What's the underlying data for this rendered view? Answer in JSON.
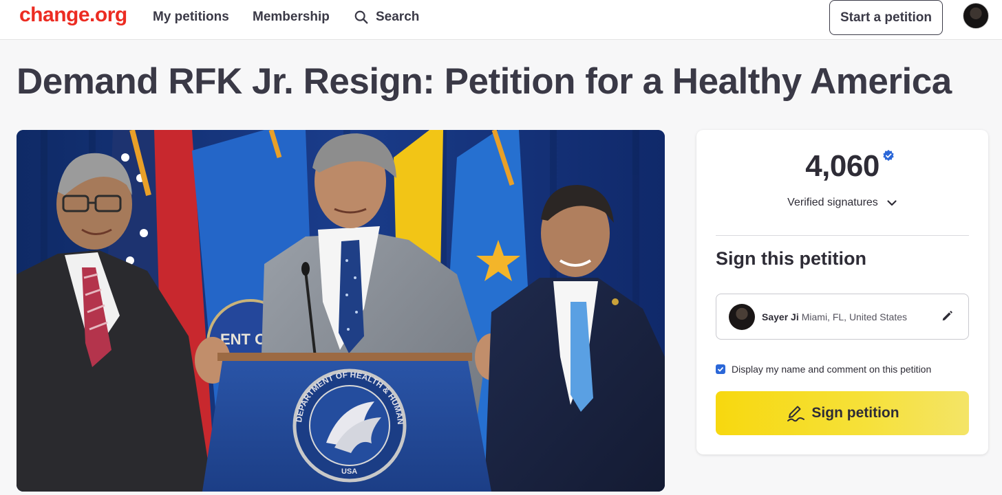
{
  "header": {
    "logo": "change.org",
    "nav": {
      "my_petitions": "My petitions",
      "membership": "Membership",
      "search": "Search"
    },
    "start_petition": "Start a petition",
    "brand_color": "#ec2c22"
  },
  "petition": {
    "title": "Demand RFK Jr. Resign: Petition for a Healthy America",
    "image_text": {
      "seal_top": "DEPARTMENT OF HEALTH & HUMAN SERVICES",
      "seal_bottom": "USA",
      "backdrop_seal": "ENT O"
    }
  },
  "signatures": {
    "count": "4,060",
    "label": "Verified signatures",
    "verified_color": "#2b67d8"
  },
  "sign_form": {
    "heading": "Sign this petition",
    "user_name": "Sayer Ji",
    "user_location": "Miami, FL, United States",
    "display_checkbox_label": "Display my name and comment on this petition",
    "display_checked": true,
    "sign_button": "Sign petition",
    "button_color": "#f7d80f"
  },
  "icons": [
    "search-icon",
    "verified-badge-icon",
    "chevron-down-icon",
    "pencil-icon",
    "checkmark-icon",
    "sign-pen-icon"
  ]
}
